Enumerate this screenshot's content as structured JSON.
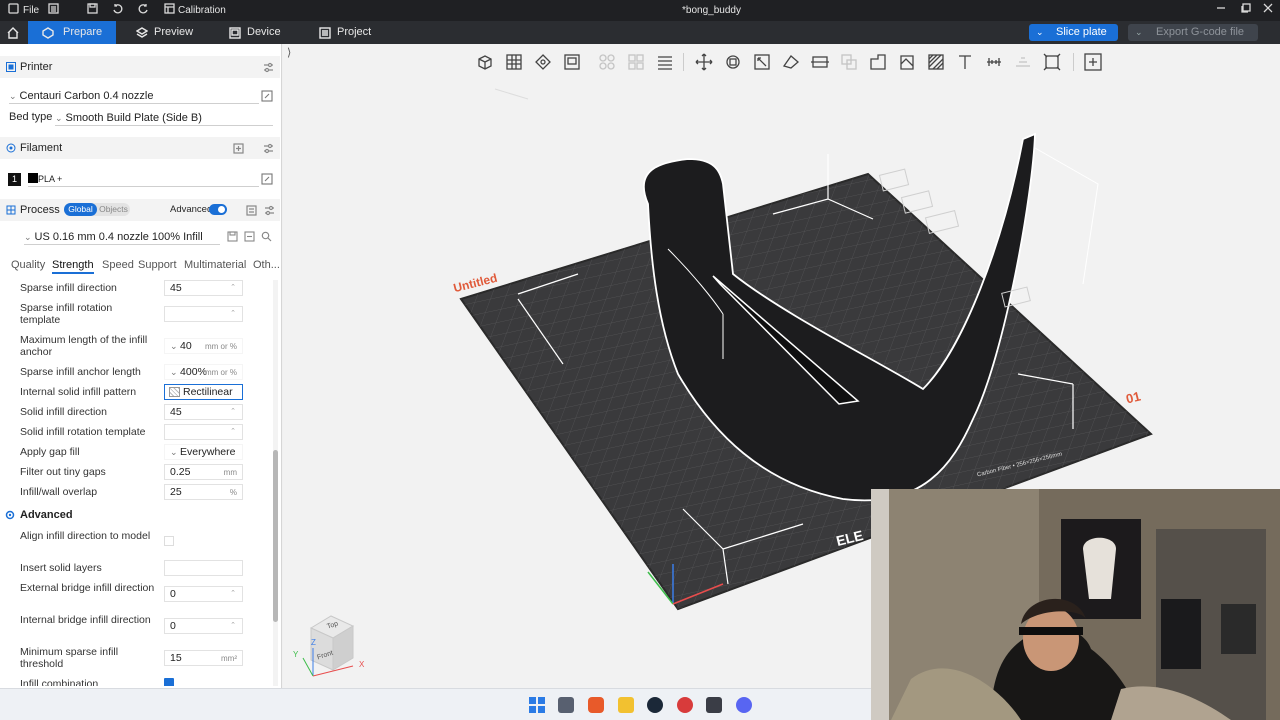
{
  "titlebar": {
    "file_label": "File",
    "calibration_label": "Calibration",
    "doc_title": "*bong_buddy"
  },
  "nav": {
    "tabs": [
      {
        "label": "Prepare",
        "icon": "prepare-icon",
        "active": true
      },
      {
        "label": "Preview",
        "icon": "preview-icon",
        "active": false
      },
      {
        "label": "Device",
        "icon": "device-icon",
        "active": false
      },
      {
        "label": "Project",
        "icon": "project-icon",
        "active": false
      }
    ],
    "slice_label": "Slice plate",
    "export_label": "Export G-code file"
  },
  "printer": {
    "title": "Printer",
    "name": "Centauri Carbon 0.4 nozzle",
    "bed_type_label": "Bed type",
    "bed_type_value": "Smooth Build Plate (Side B)"
  },
  "filament": {
    "title": "Filament",
    "slot": "1",
    "name": "PLA +"
  },
  "process": {
    "title": "Process",
    "toggle_global": "Global",
    "toggle_objects": "Objects",
    "advanced_label": "Advanced",
    "preset": "US 0.16 mm 0.4 nozzle 100% Infill",
    "tabs": [
      "Quality",
      "Strength",
      "Speed",
      "Support",
      "Multimaterial",
      "Oth..."
    ],
    "active_tab": "Strength"
  },
  "strength_rows": [
    {
      "label": "Sparse infill direction",
      "value": "45",
      "unit": ""
    },
    {
      "label": "Sparse infill rotation template",
      "value": "",
      "unit": ""
    },
    {
      "label": "Maximum length of the infill anchor",
      "value": "40",
      "unit": "mm or %"
    },
    {
      "label": "Sparse infill anchor length",
      "value": "400%",
      "unit": "mm or %"
    },
    {
      "label": "Internal solid infill pattern",
      "value": "Rectilinear",
      "unit": ""
    },
    {
      "label": "Solid infill direction",
      "value": "45",
      "unit": ""
    },
    {
      "label": "Solid infill rotation template",
      "value": "",
      "unit": ""
    },
    {
      "label": "Apply gap fill",
      "value": "Everywhere",
      "unit": ""
    },
    {
      "label": "Filter out tiny gaps",
      "value": "0.25",
      "unit": "mm"
    },
    {
      "label": "Infill/wall overlap",
      "value": "25",
      "unit": "%"
    }
  ],
  "advanced_section": {
    "title": "Advanced",
    "rows": [
      {
        "label": "Align infill direction to model",
        "value": "",
        "unit": ""
      },
      {
        "label": "Insert solid layers",
        "value": "",
        "unit": ""
      },
      {
        "label": "External bridge infill direction",
        "value": "0",
        "unit": ""
      },
      {
        "label": "Internal bridge infill direction",
        "value": "0",
        "unit": ""
      },
      {
        "label": "Minimum sparse infill threshold",
        "value": "15",
        "unit": "mm²"
      },
      {
        "label": "Infill combination",
        "value": "",
        "unit": ""
      }
    ]
  },
  "plate": {
    "name_label": "Untitled",
    "plate_number": "01",
    "brand_text": "ELE",
    "info_text": "Carbon Fiber • 256×256×256mm"
  },
  "view_cube": {
    "top_label": "Top",
    "front_label": "Front",
    "axis_x": "X",
    "axis_y": "Y",
    "axis_z": "Z"
  },
  "colors": {
    "accent": "#1a6fd6",
    "titlebar_bg": "#1f2023",
    "navbar_bg": "#2b2d31",
    "plate_bg": "#3a3a3c",
    "model": "#1c1c1e"
  }
}
